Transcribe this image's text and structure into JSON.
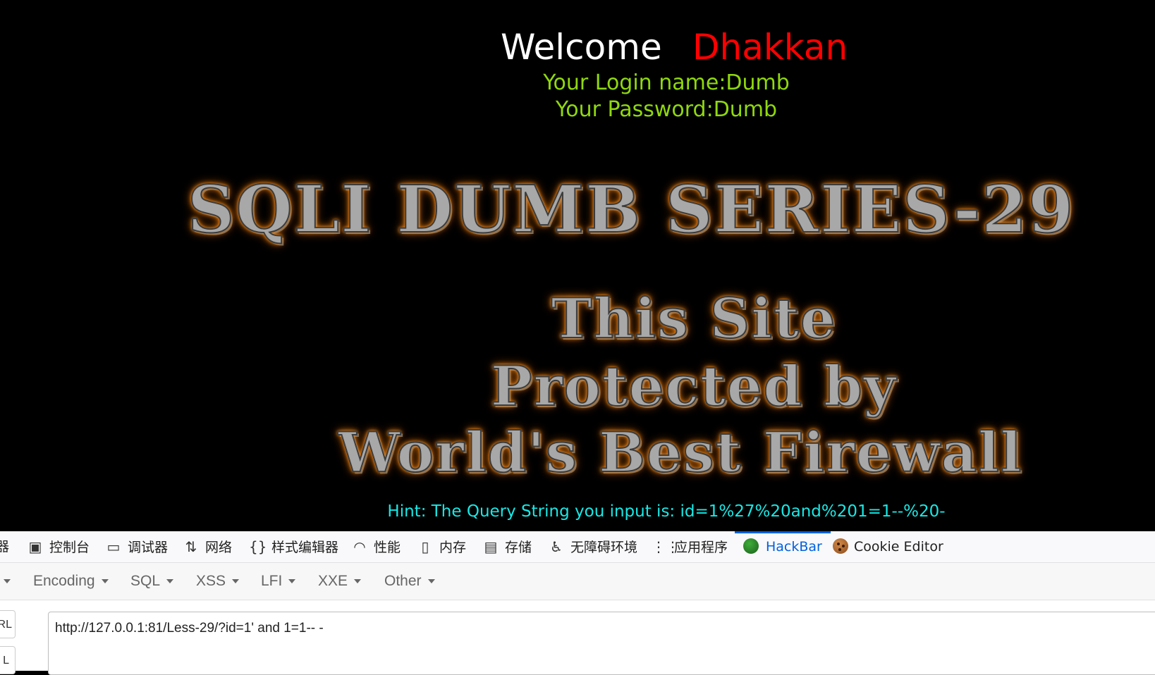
{
  "page": {
    "welcome": "Welcome",
    "name": "Dhakkan",
    "login_name": "Your Login name:Dumb",
    "password": "Your Password:Dumb",
    "banner_series": "SQLI DUMB SERIES-29",
    "banner_line1": "This Site",
    "banner_line2": "Protected by",
    "banner_line3": "World's Best Firewall",
    "hint": "Hint: The Query String you input is: id=1%27%20and%201=1--%20-"
  },
  "devtools": {
    "tabs": [
      {
        "label": "器",
        "icon": ""
      },
      {
        "label": "控制台",
        "icon": "console-icon"
      },
      {
        "label": "调试器",
        "icon": "debugger-icon"
      },
      {
        "label": "网络",
        "icon": "network-icon"
      },
      {
        "label": "样式编辑器",
        "icon": "style-editor-icon"
      },
      {
        "label": "性能",
        "icon": "performance-icon"
      },
      {
        "label": "内存",
        "icon": "memory-icon"
      },
      {
        "label": "存储",
        "icon": "storage-icon"
      },
      {
        "label": "无障碍环境",
        "icon": "accessibility-icon"
      },
      {
        "label": "应用程序",
        "icon": "application-icon"
      },
      {
        "label": "HackBar",
        "icon": "hackbar-icon",
        "active": true
      },
      {
        "label": "Cookie Editor",
        "icon": "cookie-icon"
      }
    ],
    "accent_color": "#0061e0"
  },
  "hackbar": {
    "menus": [
      "Encoding",
      "SQL",
      "XSS",
      "LFI",
      "XXE",
      "Other"
    ],
    "left_buttons": [
      "RL",
      "L"
    ],
    "url_value": "http://127.0.0.1:81/Less-29/?id=1' and 1=1-- -"
  }
}
